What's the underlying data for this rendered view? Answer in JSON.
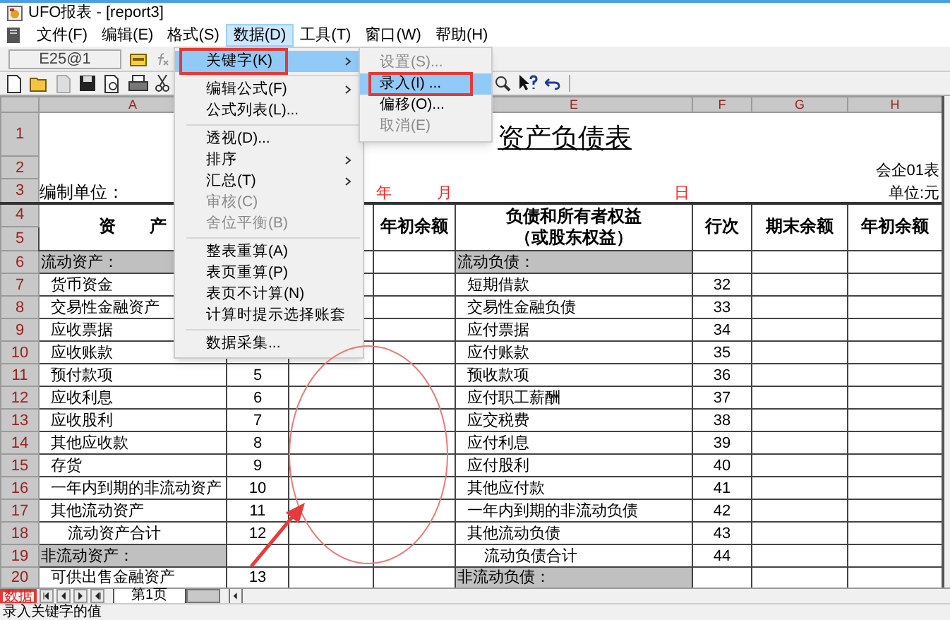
{
  "window": {
    "title": "UFO报表 - [report3]"
  },
  "menu_bar": [
    {
      "label": "文件(F)",
      "selected": false
    },
    {
      "label": "编辑(E)",
      "selected": false
    },
    {
      "label": "格式(S)",
      "selected": false
    },
    {
      "label": "数据(D)",
      "selected": true
    },
    {
      "label": "工具(T)",
      "selected": false
    },
    {
      "label": "窗口(W)",
      "selected": false
    },
    {
      "label": "帮助(H)",
      "selected": false
    }
  ],
  "data_menu": [
    {
      "kind": "item",
      "label": "关键字(K)",
      "submenu": true,
      "disabled": false,
      "selected": true,
      "marked": true
    },
    {
      "kind": "separator"
    },
    {
      "kind": "item",
      "label": "编辑公式(F)",
      "submenu": true,
      "disabled": false,
      "selected": false,
      "marked": false
    },
    {
      "kind": "item",
      "label": "公式列表(L)...",
      "submenu": false,
      "disabled": false,
      "selected": false,
      "marked": false
    },
    {
      "kind": "separator"
    },
    {
      "kind": "item",
      "label": "透视(D)...",
      "submenu": false,
      "disabled": false,
      "selected": false,
      "marked": false
    },
    {
      "kind": "item",
      "label": "排序",
      "submenu": true,
      "disabled": false,
      "selected": false,
      "marked": false
    },
    {
      "kind": "item",
      "label": "汇总(T)",
      "submenu": true,
      "disabled": false,
      "selected": false,
      "marked": false
    },
    {
      "kind": "item",
      "label": "审核(C)",
      "submenu": false,
      "disabled": true,
      "selected": false,
      "marked": false
    },
    {
      "kind": "item",
      "label": "舍位平衡(B)",
      "submenu": false,
      "disabled": true,
      "selected": false,
      "marked": false
    },
    {
      "kind": "separator"
    },
    {
      "kind": "item",
      "label": "整表重算(A)",
      "submenu": false,
      "disabled": false,
      "selected": false,
      "marked": false
    },
    {
      "kind": "item",
      "label": "表页重算(P)",
      "submenu": false,
      "disabled": false,
      "selected": false,
      "marked": false
    },
    {
      "kind": "item",
      "label": "表页不计算(N)",
      "submenu": false,
      "disabled": false,
      "selected": false,
      "marked": false
    },
    {
      "kind": "item",
      "label": "计算时提示选择账套",
      "submenu": false,
      "disabled": false,
      "selected": false,
      "marked": false
    },
    {
      "kind": "separator"
    },
    {
      "kind": "item",
      "label": "数据采集...",
      "submenu": false,
      "disabled": false,
      "selected": false,
      "marked": false
    }
  ],
  "keyword_submenu": [
    {
      "label": "设置(S)...",
      "disabled": true,
      "selected": false,
      "marked": false
    },
    {
      "label": "录入(I) ...",
      "disabled": false,
      "selected": true,
      "marked": true
    },
    {
      "label": "偏移(O)...",
      "disabled": false,
      "selected": false,
      "marked": false
    },
    {
      "label": "取消(E)",
      "disabled": true,
      "selected": false,
      "marked": false
    }
  ],
  "formula_bar": {
    "cell_ref": "E25@1"
  },
  "sheet": {
    "columns": {
      "a": "A",
      "e": "E",
      "f": "F",
      "g": "G",
      "h": "H"
    },
    "title": "资产负债表",
    "form_code": "会企01表",
    "company_label": "编制单位：",
    "date_marks": [
      "年",
      "月",
      "日"
    ],
    "unit": "单位:元",
    "header_rows": [
      "1",
      "2",
      "3",
      "4",
      "5"
    ],
    "headers": {
      "assets": "资　　产",
      "prior_assets": "年初余额",
      "liabilities": [
        "负债和所有者权益",
        "（或股东权益）"
      ],
      "line_no": "行次",
      "closing": "期末余额",
      "opening": "年初余额"
    },
    "rows": [
      {
        "number": "6",
        "asset": {
          "text": "流动资产：",
          "kind": "section"
        },
        "liability": {
          "text": "流动负债：",
          "kind": "section"
        }
      },
      {
        "number": "7",
        "asset": {
          "text": "货币资金",
          "kind": "item"
        },
        "liability": {
          "text": "短期借款",
          "kind": "item"
        },
        "liability_line": "32"
      },
      {
        "number": "8",
        "asset": {
          "text": "交易性金融资产",
          "kind": "item"
        },
        "liability": {
          "text": "交易性金融负债",
          "kind": "item"
        },
        "liability_line": "33"
      },
      {
        "number": "9",
        "asset": {
          "text": "应收票据",
          "kind": "item"
        },
        "liability": {
          "text": "应付票据",
          "kind": "item"
        },
        "liability_line": "34"
      },
      {
        "number": "10",
        "asset": {
          "text": "应收账款",
          "kind": "item"
        },
        "liability": {
          "text": "应付账款",
          "kind": "item"
        },
        "liability_line": "35"
      },
      {
        "number": "11",
        "asset": {
          "text": "预付款项",
          "kind": "item"
        },
        "asset_line": "5",
        "liability": {
          "text": "预收款项",
          "kind": "item"
        },
        "liability_line": "36"
      },
      {
        "number": "12",
        "asset": {
          "text": "应收利息",
          "kind": "item"
        },
        "asset_line": "6",
        "liability": {
          "text": "应付职工薪酬",
          "kind": "item"
        },
        "liability_line": "37"
      },
      {
        "number": "13",
        "asset": {
          "text": "应收股利",
          "kind": "item"
        },
        "asset_line": "7",
        "liability": {
          "text": "应交税费",
          "kind": "item"
        },
        "liability_line": "38"
      },
      {
        "number": "14",
        "asset": {
          "text": "其他应收款",
          "kind": "item"
        },
        "asset_line": "8",
        "liability": {
          "text": "应付利息",
          "kind": "item"
        },
        "liability_line": "39"
      },
      {
        "number": "15",
        "asset": {
          "text": "存货",
          "kind": "item"
        },
        "asset_line": "9",
        "liability": {
          "text": "应付股利",
          "kind": "item"
        },
        "liability_line": "40"
      },
      {
        "number": "16",
        "asset": {
          "text": "一年内到期的非流动资产",
          "kind": "item"
        },
        "asset_line": "10",
        "liability": {
          "text": "其他应付款",
          "kind": "item"
        },
        "liability_line": "41"
      },
      {
        "number": "17",
        "asset": {
          "text": "其他流动资产",
          "kind": "item"
        },
        "asset_line": "11",
        "liability": {
          "text": "一年内到期的非流动负债",
          "kind": "item"
        },
        "liability_line": "42"
      },
      {
        "number": "18",
        "asset": {
          "text": "流动资产合计",
          "kind": "total"
        },
        "asset_line": "12",
        "liability": {
          "text": "其他流动负债",
          "kind": "item"
        },
        "liability_line": "43"
      },
      {
        "number": "19",
        "asset": {
          "text": "非流动资产：",
          "kind": "section"
        },
        "liability": {
          "text": "流动负债合计",
          "kind": "total"
        },
        "liability_line": "44"
      },
      {
        "number": "20",
        "asset": {
          "text": "可供出售金融资产",
          "kind": "item"
        },
        "asset_line": "13",
        "liability": {
          "text": "非流动负债：",
          "kind": "section"
        }
      }
    ]
  },
  "sheet_tabs": {
    "mode": "数据",
    "mode_marked": true,
    "tabs": [
      {
        "label": "第1页",
        "selected": true
      }
    ]
  },
  "status_bar": "录入关键字的值"
}
